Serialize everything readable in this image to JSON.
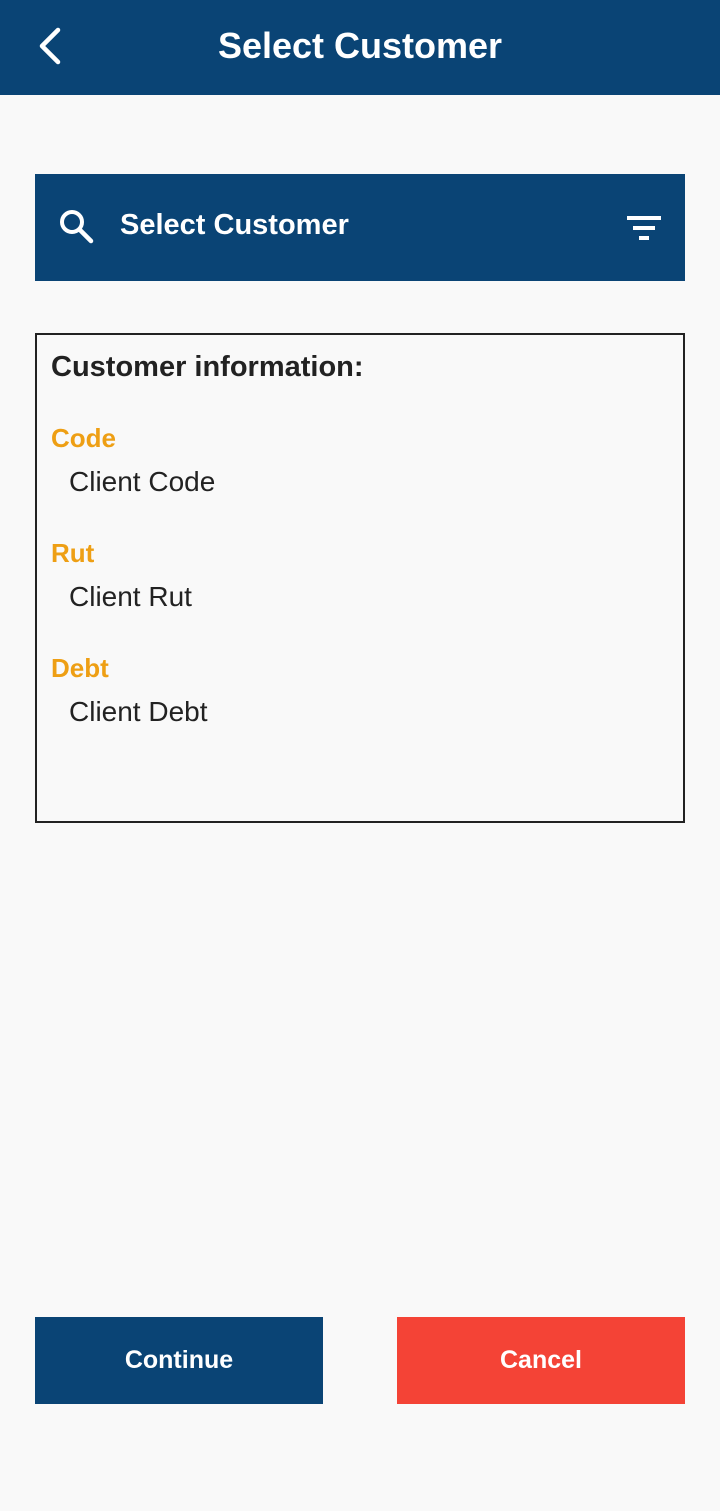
{
  "colors": {
    "primary": "#0a4475",
    "accent_label": "#ee9f14",
    "danger": "#f44336",
    "background": "#f9f9f9",
    "text": "#222222"
  },
  "header": {
    "title": "Select Customer",
    "back_icon": "chevron-left-icon"
  },
  "search": {
    "label": "Select Customer",
    "search_icon": "search-icon",
    "filter_icon": "filter-icon"
  },
  "customer_info": {
    "heading": "Customer information:",
    "fields": [
      {
        "label": "Code",
        "value": "Client Code"
      },
      {
        "label": "Rut",
        "value": "Client Rut"
      },
      {
        "label": "Debt",
        "value": "Client Debt"
      }
    ]
  },
  "actions": {
    "continue_label": "Continue",
    "cancel_label": "Cancel"
  }
}
